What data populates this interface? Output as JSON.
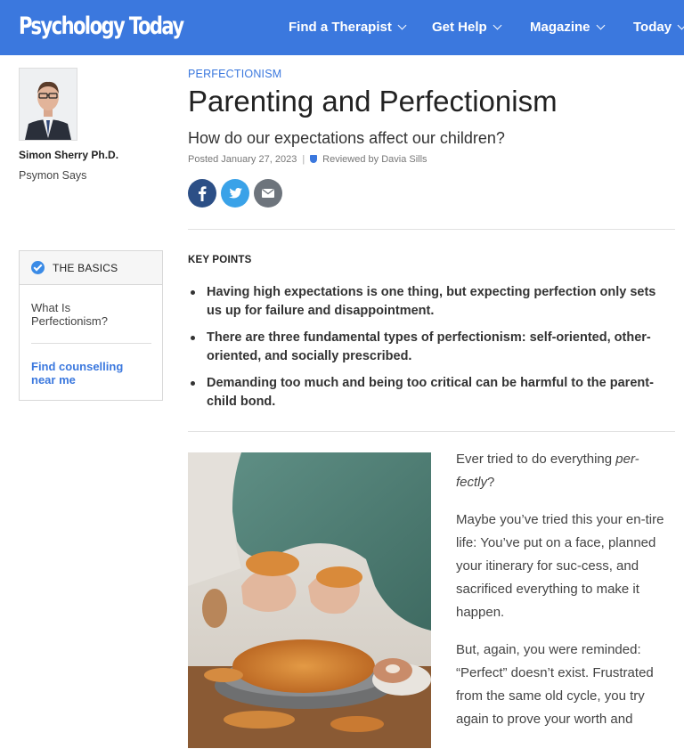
{
  "header": {
    "logo": "Psychology Today",
    "nav": [
      {
        "label": "Find a Therapist"
      },
      {
        "label": "Get Help"
      },
      {
        "label": "Magazine"
      },
      {
        "label": "Today"
      }
    ],
    "colors": {
      "bar": "#3b78de"
    }
  },
  "author": {
    "name": "Simon Sherry Ph.D.",
    "blog": "Psymon Says"
  },
  "basics": {
    "title": "THE BASICS",
    "link1": "What Is Perfectionism?",
    "link2": "Find counselling near me"
  },
  "article": {
    "kicker": "PERFECTIONISM",
    "title": "Parenting and Perfectionism",
    "subtitle": "How do our expectations affect our children?",
    "posted": "Posted January 27, 2023",
    "divider": "|",
    "reviewed": "Reviewed by Davia Sills",
    "share": [
      "facebook-icon",
      "twitter-icon",
      "email-icon"
    ],
    "key_points_title": "KEY POINTS",
    "key_points": [
      "Having high expectations is one thing, but expecting perfection only sets us up for failure and disappointment.",
      "There are three fundamental types of perfectionism: self-oriented, other-oriented, and socially prescribed.",
      "Demanding too much and being too critical can be harmful to the parent-child bond."
    ],
    "body": {
      "p1_before": "Ever tried to do everything ",
      "p1_em": "per-fectly",
      "p1_after": "?",
      "p2": "Maybe you’ve tried this your en-tire life: You’ve put on a face, planned your itinerary for suc-cess, and sacrificed everything to make it happen.",
      "p3": "But, again, you were reminded: “Perfect” doesn’t exist. Frustrated from the same old cycle, you try again to prove your worth and"
    }
  }
}
